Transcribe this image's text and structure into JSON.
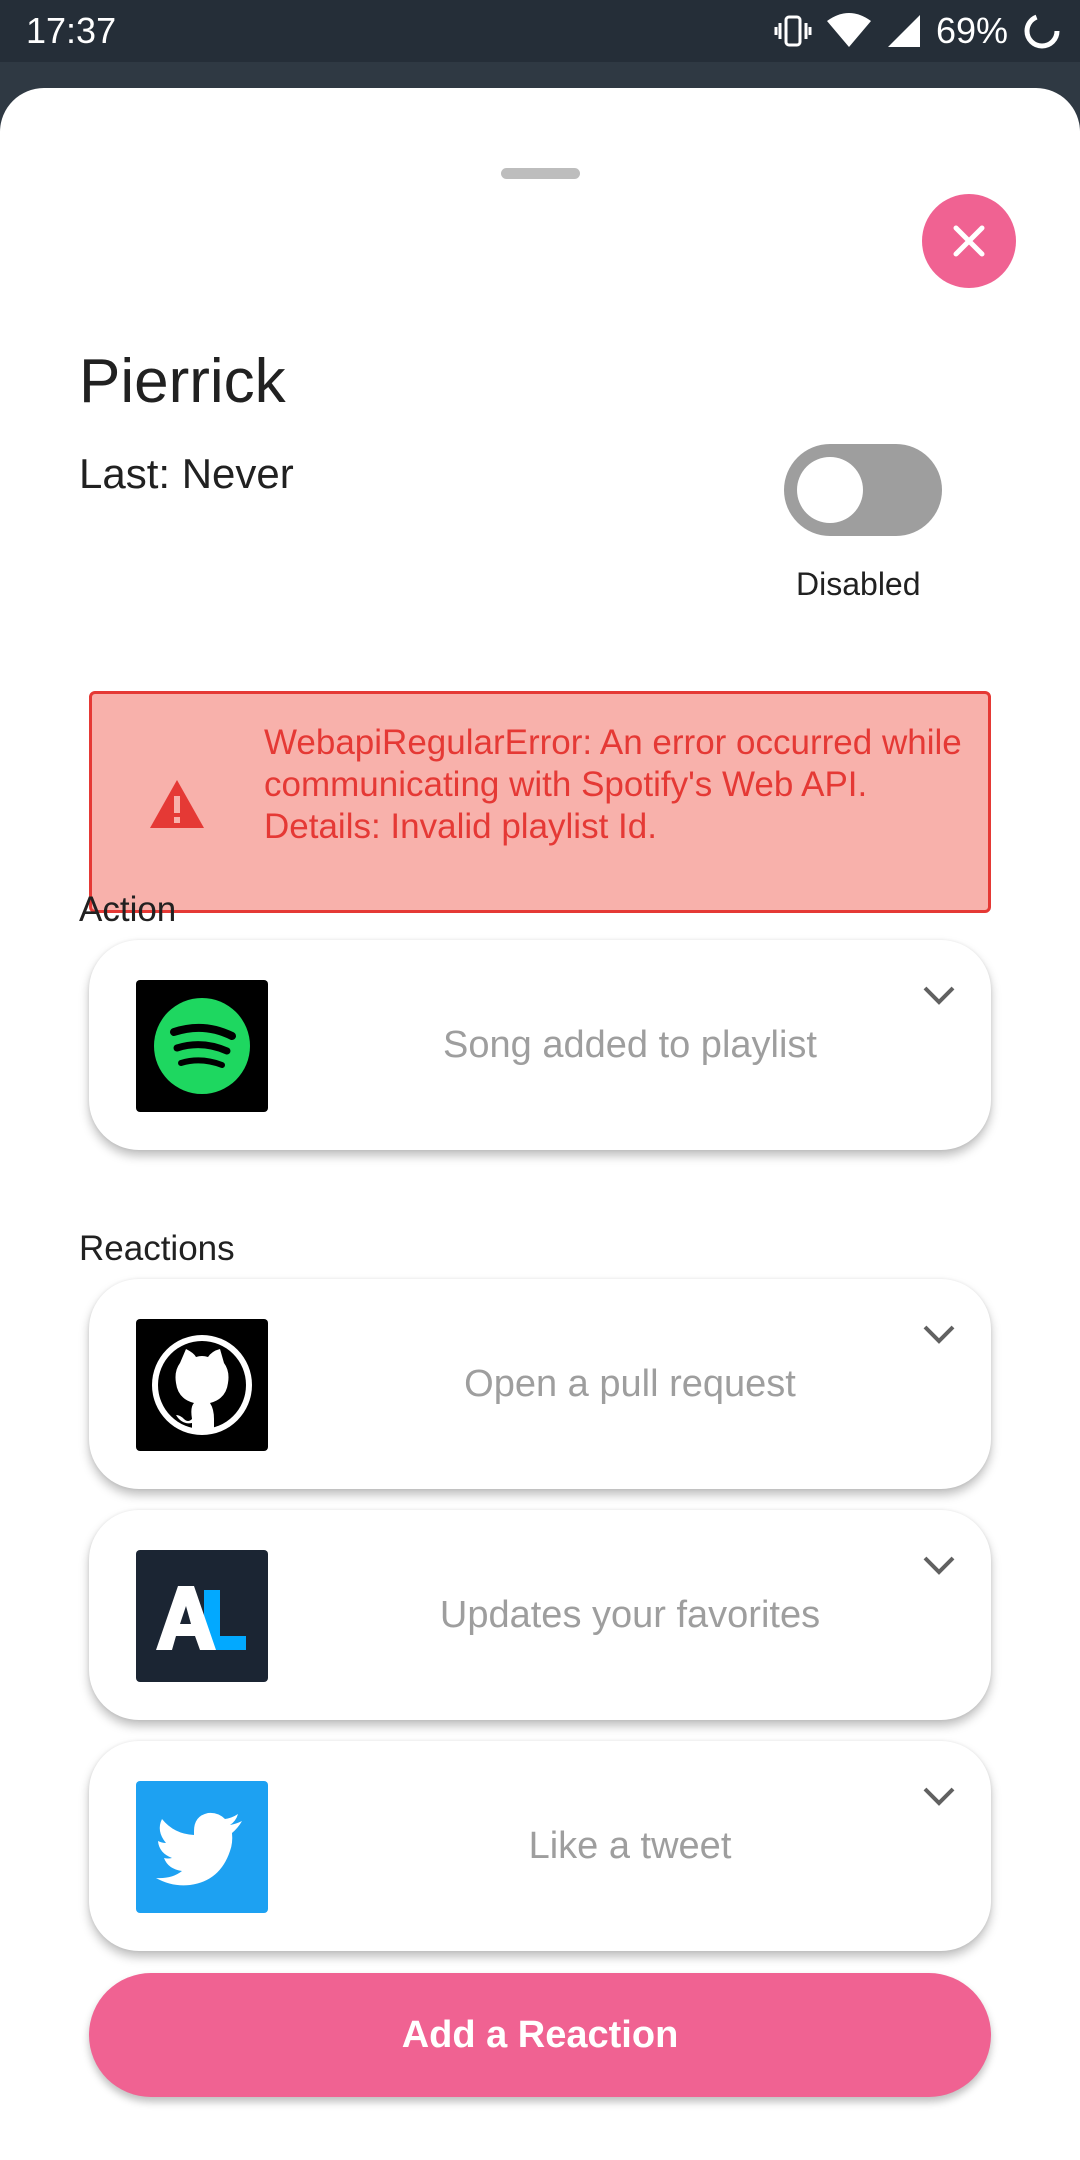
{
  "status_bar": {
    "time": "17:37",
    "battery": "69%",
    "icons": [
      "vibrate-icon",
      "wifi-icon",
      "signal-icon",
      "battery-icon"
    ]
  },
  "area": {
    "name": "Pierrick",
    "last_run": "Last: Never",
    "toggle_state_label": "Disabled",
    "enabled": false
  },
  "error": {
    "message": "WebapiRegularError: An error occurred while communicating with Spotify's Web API.\nDetails: Invalid playlist Id.",
    "icon": "warning-icon"
  },
  "action": {
    "section_label": "Action",
    "service": "spotify",
    "label": "Song added to playlist"
  },
  "reactions": {
    "section_label": "Reactions",
    "items": [
      {
        "service": "github",
        "label": "Open a pull request"
      },
      {
        "service": "anilist",
        "label": "Updates your favorites"
      },
      {
        "service": "twitter",
        "label": "Like a tweet"
      }
    ]
  },
  "add_button": {
    "label": "Add a Reaction"
  },
  "colors": {
    "accent": "#f06292",
    "error_text": "#e53935",
    "error_bg": "#f8b1ab",
    "spotify_green": "#1ed760",
    "twitter_blue": "#1da1f2",
    "anilist_dark": "#1b2533",
    "anilist_blue": "#02a9ff"
  }
}
